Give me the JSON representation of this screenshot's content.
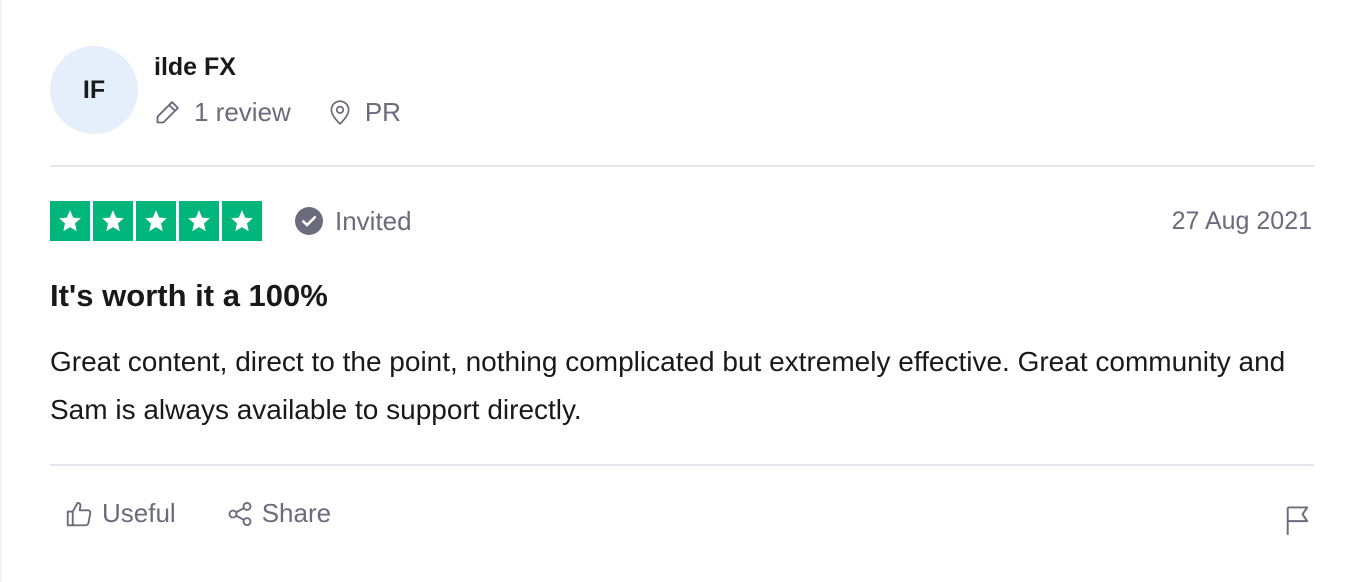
{
  "consumer": {
    "initials": "IF",
    "name": "ilde FX",
    "review_count": "1 review",
    "country": "PR"
  },
  "review": {
    "rating": 5,
    "invited_label": "Invited",
    "date": "27 Aug 2021",
    "title": "It's worth it a 100%",
    "body": "Great content, direct to the point, nothing complicated but extremely effective. Great community and Sam is always available to support directly."
  },
  "actions": {
    "useful_label": "Useful",
    "share_label": "Share"
  },
  "colors": {
    "star_green": "#00b67a",
    "avatar_bg": "#e5eefb",
    "muted_text": "#6b6b7d"
  },
  "icons": {
    "review_count": "pencil-icon",
    "country": "location-pin-icon",
    "invited": "check-circle-icon",
    "useful": "thumbs-up-icon",
    "share": "share-icon",
    "report": "flag-icon"
  }
}
